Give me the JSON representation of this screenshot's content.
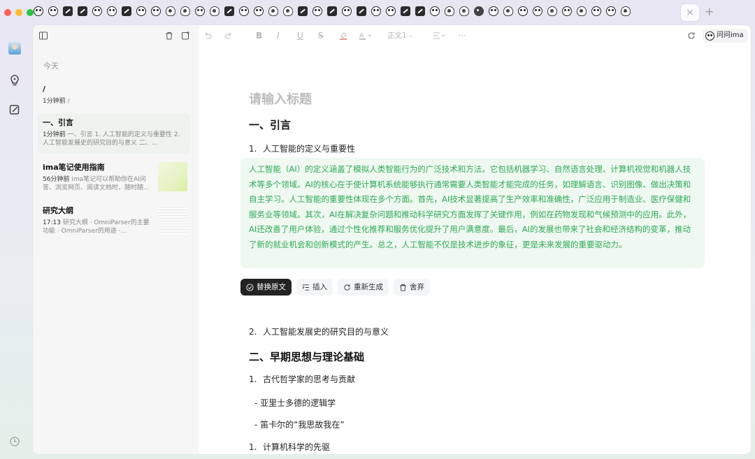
{
  "tabs_count": 44,
  "tab_kinds": [
    "panda",
    "panda",
    "edit",
    "edit",
    "panda",
    "panda",
    "edit",
    "panda",
    "panda",
    "bulb",
    "bulb",
    "panda",
    "bulb",
    "edit",
    "panda",
    "panda",
    "bulb",
    "bulb",
    "edit",
    "panda",
    "edit",
    "panda",
    "edit",
    "panda",
    "panda",
    "edit",
    "edit",
    "panda",
    "bulb",
    "bulb",
    "gear",
    "panda",
    "bulb",
    "panda",
    "panda",
    "bulb",
    "panda",
    "bulb",
    "panda",
    "panda",
    "bulb"
  ],
  "tabbar": {
    "close_glyph": "×",
    "new_glyph": "+"
  },
  "toolbar": {
    "body_style": "正文1",
    "more": "···",
    "ask_ima": "问问ima"
  },
  "sidebar": {
    "section": "今天",
    "notes": [
      {
        "title": "/",
        "time": "1分钟前",
        "snippet": "/"
      },
      {
        "title": "一、引言",
        "time": "1分钟前",
        "snippet": "一、引言  1. 人工智能的定义与重要性  2. 人工智能发展史的研究目的与意义  二、..."
      },
      {
        "title": "ima笔记使用指南",
        "time": "56分钟前",
        "snippet": "ima笔记可以帮助你在AI问答、浏览网页、阅读文档时，随时随..."
      },
      {
        "title": "研究大纲",
        "time": "17:13",
        "snippet": "研究大纲  · OmniParser的主要功能  · OmniParser的用途  ·..."
      }
    ]
  },
  "editor": {
    "title_placeholder": "请输入标题",
    "h1_1": "一、引言",
    "item1_num": "1.",
    "item1": "人工智能的定义与重要性",
    "ai_text": "人工智能（AI）的定义涵盖了模拟人类智能行为的广泛技术和方法。它包括机器学习、自然语言处理、计算机视觉和机器人技术等多个领域。AI的核心在于使计算机系统能够执行通常需要人类智能才能完成的任务，如理解语言、识别图像、做出决策和自主学习。人工智能的重要性体现在多个方面。首先，AI技术显著提高了生产效率和准确性，广泛应用于制造业、医疗保健和服务业等领域。其次，AI在解决复杂问题和推动科学研究方面发挥了关键作用，例如在药物发现和气候预测中的应用。此外，AI还改善了用户体验，通过个性化推荐和服务优化提升了用户满意度。最后，AI的发展也带来了社会和经济结构的变革，推动了新的就业机会和创新模式的产生。总之，人工智能不仅是技术进步的象征，更是未来发展的重要驱动力。",
    "actions": {
      "replace": "替换原文",
      "insert": "插入",
      "regenerate": "重新生成",
      "discard": "舍弃"
    },
    "item2_num": "2.",
    "item2": "人工智能发展史的研究目的与意义",
    "h1_2": "二、早期思想与理论基础",
    "item3_num": "1.",
    "item3": "古代哲学家的思考与贡献",
    "sub1": "- 亚里士多德的逻辑学",
    "sub2": "- 笛卡尔的“我思故我在”",
    "item4_num": "1.",
    "item4": "计算机科学的先驱"
  },
  "colors": {
    "accent_green": "#2daa55",
    "ai_block_bg": "#f0f8f2",
    "primary_button": "#232323"
  }
}
